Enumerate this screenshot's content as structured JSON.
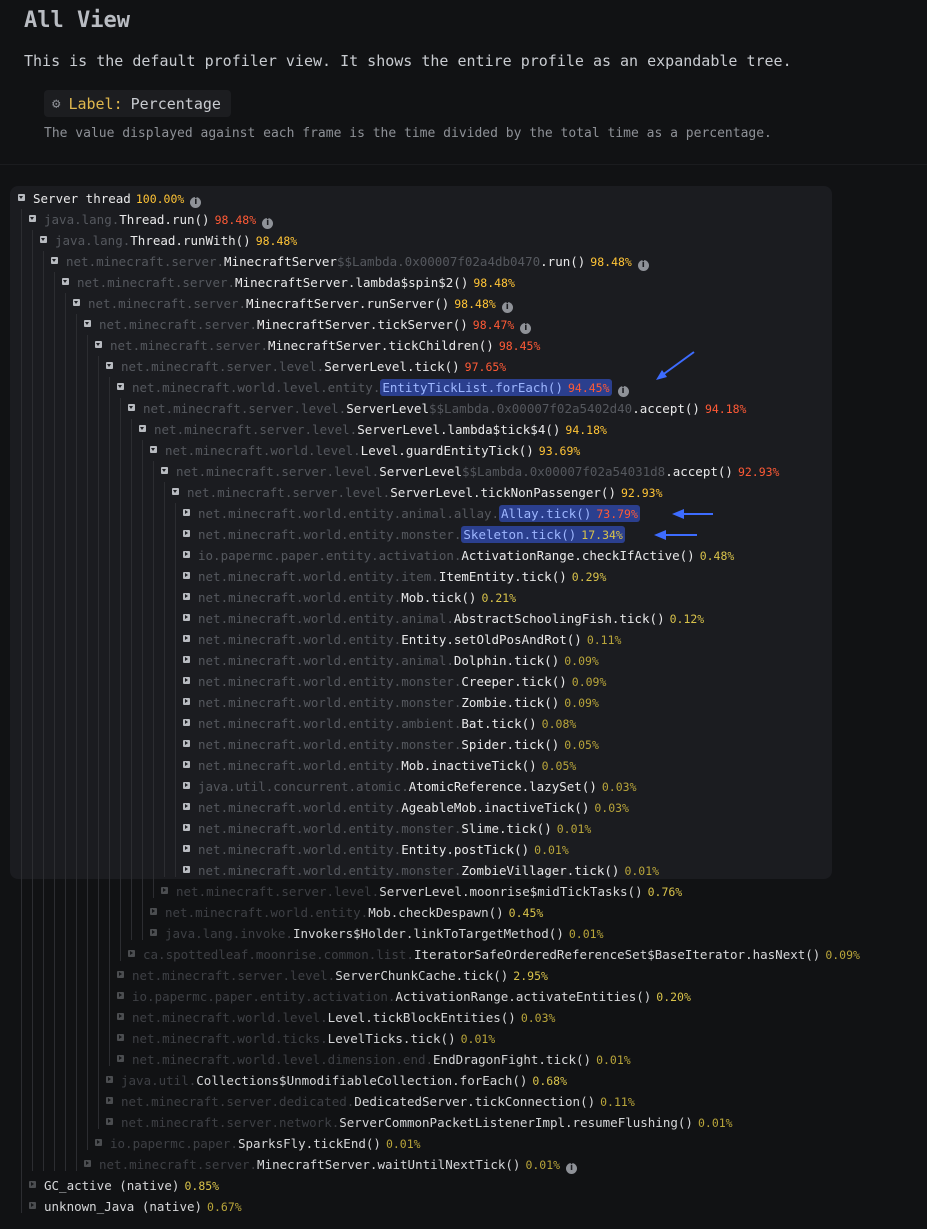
{
  "heading": "All View",
  "description": "This is the default profiler view. It shows the entire profile as an expandable tree.",
  "label_setting": {
    "key": "Label:",
    "value": "Percentage",
    "icon": "gear-icon"
  },
  "label_description": "The value displayed against each frame is the time divided by the total time as a percentage.",
  "colors": {
    "hot": "#ff5a36",
    "warm": "#ffc436",
    "mild": "#d8c24a",
    "cool": "#b9a53a",
    "highlight": "#2b3f8e",
    "arrow": "#3d6cff"
  },
  "tree": [
    {
      "d": 0,
      "pkg": "",
      "fn": "Server thread",
      "pct": "100.00%",
      "heat": "warm",
      "toggle": "exp",
      "info": true
    },
    {
      "d": 1,
      "pkg": "java.lang.",
      "fn": "Thread.run()",
      "pct": "98.48%",
      "heat": "hot",
      "toggle": "exp",
      "info": true
    },
    {
      "d": 2,
      "pkg": "java.lang.",
      "fn": "Thread.runWith()",
      "pct": "98.48%",
      "heat": "warm",
      "toggle": "exp"
    },
    {
      "d": 3,
      "pkg": "net.minecraft.server.",
      "fn": "MinecraftServer",
      "mid": "$$Lambda.0x00007f02a4db0470",
      "fn2": ".run()",
      "pct": "98.48%",
      "heat": "warm",
      "toggle": "exp",
      "info": true
    },
    {
      "d": 4,
      "pkg": "net.minecraft.server.",
      "fn": "MinecraftServer.lambda$spin$2()",
      "pct": "98.48%",
      "heat": "warm",
      "toggle": "exp"
    },
    {
      "d": 5,
      "pkg": "net.minecraft.server.",
      "fn": "MinecraftServer.runServer()",
      "pct": "98.48%",
      "heat": "warm",
      "toggle": "exp",
      "info": true
    },
    {
      "d": 6,
      "pkg": "net.minecraft.server.",
      "fn": "MinecraftServer.tickServer()",
      "pct": "98.47%",
      "heat": "hot",
      "toggle": "exp",
      "info": true
    },
    {
      "d": 7,
      "pkg": "net.minecraft.server.",
      "fn": "MinecraftServer.tickChildren()",
      "pct": "98.45%",
      "heat": "hot",
      "toggle": "exp"
    },
    {
      "d": 8,
      "pkg": "net.minecraft.server.level.",
      "fn": "ServerLevel.tick()",
      "pct": "97.65%",
      "heat": "hot",
      "toggle": "exp"
    },
    {
      "d": 9,
      "pkg": "net.minecraft.world.level.entity.",
      "fn": "EntityTickList.forEach()",
      "pct": "94.45%",
      "heat": "hot",
      "toggle": "exp",
      "info": true,
      "hl": true,
      "hlpkg": false
    },
    {
      "d": 10,
      "pkg": "net.minecraft.server.level.",
      "fn": "ServerLevel",
      "mid": "$$Lambda.0x00007f02a5402d40",
      "fn2": ".accept()",
      "pct": "94.18%",
      "heat": "hot",
      "toggle": "exp"
    },
    {
      "d": 11,
      "pkg": "net.minecraft.server.level.",
      "fn": "ServerLevel.lambda$tick$4()",
      "pct": "94.18%",
      "heat": "warm",
      "toggle": "exp"
    },
    {
      "d": 12,
      "pkg": "net.minecraft.world.level.",
      "fn": "Level.guardEntityTick()",
      "pct": "93.69%",
      "heat": "warm",
      "toggle": "exp"
    },
    {
      "d": 13,
      "pkg": "net.minecraft.server.level.",
      "fn": "ServerLevel",
      "mid": "$$Lambda.0x00007f02a54031d8",
      "fn2": ".accept()",
      "pct": "92.93%",
      "heat": "hot",
      "toggle": "exp"
    },
    {
      "d": 14,
      "pkg": "net.minecraft.server.level.",
      "fn": "ServerLevel.tickNonPassenger()",
      "pct": "92.93%",
      "heat": "warm",
      "toggle": "exp"
    },
    {
      "d": 15,
      "pkg": "net.minecraft.world.entity.animal.allay.",
      "fn": "Allay.tick()",
      "pct": "73.79%",
      "heat": "hot",
      "toggle": "col",
      "hl": true
    },
    {
      "d": 15,
      "pkg": "net.minecraft.world.entity.monster.",
      "fn": "Skeleton.tick()",
      "pct": "17.34%",
      "heat": "mild",
      "toggle": "col",
      "hl": true
    },
    {
      "d": 15,
      "pkg": "io.papermc.paper.entity.activation.",
      "fn": "ActivationRange.checkIfActive()",
      "pct": "0.48%",
      "heat": "mild",
      "toggle": "col"
    },
    {
      "d": 15,
      "pkg": "net.minecraft.world.entity.item.",
      "fn": "ItemEntity.tick()",
      "pct": "0.29%",
      "heat": "mild",
      "toggle": "col"
    },
    {
      "d": 15,
      "pkg": "net.minecraft.world.entity.",
      "fn": "Mob.tick()",
      "pct": "0.21%",
      "heat": "mild",
      "toggle": "col"
    },
    {
      "d": 15,
      "pkg": "net.minecraft.world.entity.animal.",
      "fn": "AbstractSchoolingFish.tick()",
      "pct": "0.12%",
      "heat": "mild",
      "toggle": "col"
    },
    {
      "d": 15,
      "pkg": "net.minecraft.world.entity.",
      "fn": "Entity.setOldPosAndRot()",
      "pct": "0.11%",
      "heat": "cool",
      "toggle": "col"
    },
    {
      "d": 15,
      "pkg": "net.minecraft.world.entity.animal.",
      "fn": "Dolphin.tick()",
      "pct": "0.09%",
      "heat": "cool",
      "toggle": "col"
    },
    {
      "d": 15,
      "pkg": "net.minecraft.world.entity.monster.",
      "fn": "Creeper.tick()",
      "pct": "0.09%",
      "heat": "cool",
      "toggle": "col"
    },
    {
      "d": 15,
      "pkg": "net.minecraft.world.entity.monster.",
      "fn": "Zombie.tick()",
      "pct": "0.09%",
      "heat": "cool",
      "toggle": "col"
    },
    {
      "d": 15,
      "pkg": "net.minecraft.world.entity.ambient.",
      "fn": "Bat.tick()",
      "pct": "0.08%",
      "heat": "cool",
      "toggle": "col"
    },
    {
      "d": 15,
      "pkg": "net.minecraft.world.entity.monster.",
      "fn": "Spider.tick()",
      "pct": "0.05%",
      "heat": "cool",
      "toggle": "col"
    },
    {
      "d": 15,
      "pkg": "net.minecraft.world.entity.",
      "fn": "Mob.inactiveTick()",
      "pct": "0.05%",
      "heat": "cool",
      "toggle": "col"
    },
    {
      "d": 15,
      "pkg": "java.util.concurrent.atomic.",
      "fn": "AtomicReference.lazySet()",
      "pct": "0.03%",
      "heat": "cool",
      "toggle": "col"
    },
    {
      "d": 15,
      "pkg": "net.minecraft.world.entity.",
      "fn": "AgeableMob.inactiveTick()",
      "pct": "0.03%",
      "heat": "cool",
      "toggle": "col"
    },
    {
      "d": 15,
      "pkg": "net.minecraft.world.entity.monster.",
      "fn": "Slime.tick()",
      "pct": "0.01%",
      "heat": "cool",
      "toggle": "col"
    },
    {
      "d": 15,
      "pkg": "net.minecraft.world.entity.",
      "fn": "Entity.postTick()",
      "pct": "0.01%",
      "heat": "cool",
      "toggle": "col"
    },
    {
      "d": 15,
      "pkg": "net.minecraft.world.entity.monster.",
      "fn": "ZombieVillager.tick()",
      "pct": "0.01%",
      "heat": "cool",
      "toggle": "col"
    },
    {
      "d": 13,
      "pkg": "net.minecraft.server.level.",
      "fn": "ServerLevel.moonrise$midTickTasks()",
      "pct": "0.76%",
      "heat": "mild",
      "toggle": "col",
      "dim": true
    },
    {
      "d": 12,
      "pkg": "net.minecraft.world.entity.",
      "fn": "Mob.checkDespawn()",
      "pct": "0.45%",
      "heat": "mild",
      "toggle": "col",
      "dim": true
    },
    {
      "d": 12,
      "pkg": "java.lang.invoke.",
      "fn": "Invokers$Holder.linkToTargetMethod()",
      "pct": "0.01%",
      "heat": "cool",
      "toggle": "col",
      "dim": true
    },
    {
      "d": 10,
      "pkg": "ca.spottedleaf.moonrise.common.list.",
      "fn": "IteratorSafeOrderedReferenceSet$BaseIterator.hasNext()",
      "pct": "0.09%",
      "heat": "cool",
      "toggle": "col",
      "dim": true
    },
    {
      "d": 9,
      "pkg": "net.minecraft.server.level.",
      "fn": "ServerChunkCache.tick()",
      "pct": "2.95%",
      "heat": "mild",
      "toggle": "col",
      "dim": true
    },
    {
      "d": 9,
      "pkg": "io.papermc.paper.entity.activation.",
      "fn": "ActivationRange.activateEntities()",
      "pct": "0.20%",
      "heat": "mild",
      "toggle": "col",
      "dim": true
    },
    {
      "d": 9,
      "pkg": "net.minecraft.world.level.",
      "fn": "Level.tickBlockEntities()",
      "pct": "0.03%",
      "heat": "cool",
      "toggle": "col",
      "dim": true
    },
    {
      "d": 9,
      "pkg": "net.minecraft.world.ticks.",
      "fn": "LevelTicks.tick()",
      "pct": "0.01%",
      "heat": "cool",
      "toggle": "col",
      "dim": true
    },
    {
      "d": 9,
      "pkg": "net.minecraft.world.level.dimension.end.",
      "fn": "EndDragonFight.tick()",
      "pct": "0.01%",
      "heat": "cool",
      "toggle": "col",
      "dim": true
    },
    {
      "d": 8,
      "pkg": "java.util.",
      "fn": "Collections$UnmodifiableCollection.forEach()",
      "pct": "0.68%",
      "heat": "mild",
      "toggle": "col",
      "dim": true
    },
    {
      "d": 8,
      "pkg": "net.minecraft.server.dedicated.",
      "fn": "DedicatedServer.tickConnection()",
      "pct": "0.11%",
      "heat": "cool",
      "toggle": "col",
      "dim": true
    },
    {
      "d": 8,
      "pkg": "net.minecraft.server.network.",
      "fn": "ServerCommonPacketListenerImpl.resumeFlushing()",
      "pct": "0.01%",
      "heat": "cool",
      "toggle": "col",
      "dim": true
    },
    {
      "d": 7,
      "pkg": "io.papermc.paper.",
      "fn": "SparksFly.tickEnd()",
      "pct": "0.01%",
      "heat": "cool",
      "toggle": "col",
      "dim": true
    },
    {
      "d": 6,
      "pkg": "net.minecraft.server.",
      "fn": "MinecraftServer.waitUntilNextTick()",
      "pct": "0.01%",
      "heat": "cool",
      "toggle": "col",
      "dim": true,
      "info": true
    },
    {
      "d": 1,
      "pkg": "",
      "fn": "GC_active (native)",
      "pct": "0.85%",
      "heat": "mild",
      "toggle": "col",
      "dim": true
    },
    {
      "d": 1,
      "pkg": "",
      "fn": "unknown_Java (native)",
      "pct": "0.67%",
      "heat": "cool",
      "toggle": "col",
      "dim": true
    }
  ]
}
